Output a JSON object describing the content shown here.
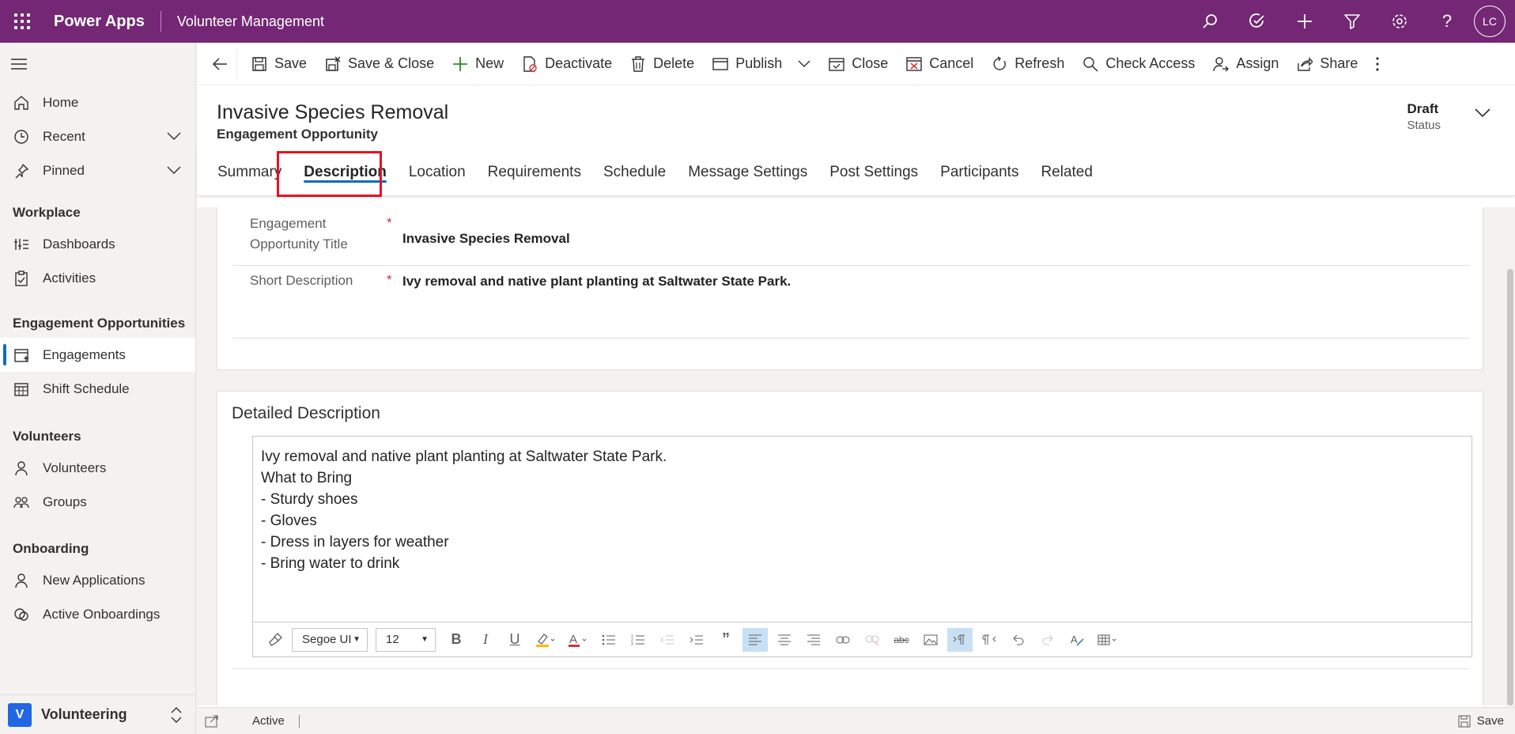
{
  "topbar": {
    "app_name": "Power Apps",
    "app_title": "Volunteer Management",
    "avatar_initials": "LC",
    "icons": [
      "search-icon",
      "assistant-icon",
      "add-icon",
      "filter-icon",
      "settings-icon",
      "help-icon"
    ],
    "color": "#742774"
  },
  "sidebar": {
    "top_items": [
      {
        "label": "Home",
        "icon": "home-icon"
      },
      {
        "label": "Recent",
        "icon": "clock-icon"
      },
      {
        "label": "Pinned",
        "icon": "pin-icon"
      }
    ],
    "sections": [
      {
        "title": "Workplace",
        "items": [
          {
            "label": "Dashboards",
            "icon": "dashboard-icon"
          },
          {
            "label": "Activities",
            "icon": "clipboard-icon"
          }
        ]
      },
      {
        "title": "Engagement Opportunities",
        "items": [
          {
            "label": "Engagements",
            "icon": "calendar-icon"
          },
          {
            "label": "Shift Schedule",
            "icon": "calendar-grid-icon"
          }
        ]
      },
      {
        "title": "Volunteers",
        "items": [
          {
            "label": "Volunteers",
            "icon": "person-icon"
          },
          {
            "label": "Groups",
            "icon": "group-icon"
          }
        ]
      },
      {
        "title": "Onboarding",
        "items": [
          {
            "label": "New Applications",
            "icon": "person-icon"
          },
          {
            "label": "Active Onboardings",
            "icon": "onboarding-icon"
          }
        ]
      }
    ],
    "area": {
      "badge": "V",
      "label": "Volunteering"
    }
  },
  "commands": {
    "save": "Save",
    "save_close": "Save & Close",
    "new": "New",
    "deactivate": "Deactivate",
    "delete": "Delete",
    "publish": "Publish",
    "close": "Close",
    "cancel": "Cancel",
    "refresh": "Refresh",
    "check_access": "Check Access",
    "assign": "Assign",
    "share": "Share"
  },
  "record": {
    "title": "Invasive Species Removal",
    "entity": "Engagement Opportunity",
    "status_value": "Draft",
    "status_label": "Status"
  },
  "tabs": [
    "Summary",
    "Description",
    "Location",
    "Requirements",
    "Schedule",
    "Message Settings",
    "Post Settings",
    "Participants",
    "Related"
  ],
  "active_tab": "Description",
  "fields": {
    "title_label_1": "Engagement",
    "title_label_2": "Opportunity Title",
    "title_value": "Invasive Species Removal",
    "short_label": "Short Description",
    "short_value": "Ivy removal and native plant planting at Saltwater State Park.",
    "required_mark": "*"
  },
  "detailed": {
    "section_title": "Detailed Description",
    "lines": [
      "Ivy removal and native plant planting at Saltwater State Park.",
      "What to Bring",
      "- Sturdy shoes",
      "- Gloves",
      "- Dress in layers for weather",
      "- Bring water to drink"
    ],
    "font": "Segoe UI",
    "font_size": "12"
  },
  "statusbar": {
    "state": "Active",
    "save": "Save"
  }
}
